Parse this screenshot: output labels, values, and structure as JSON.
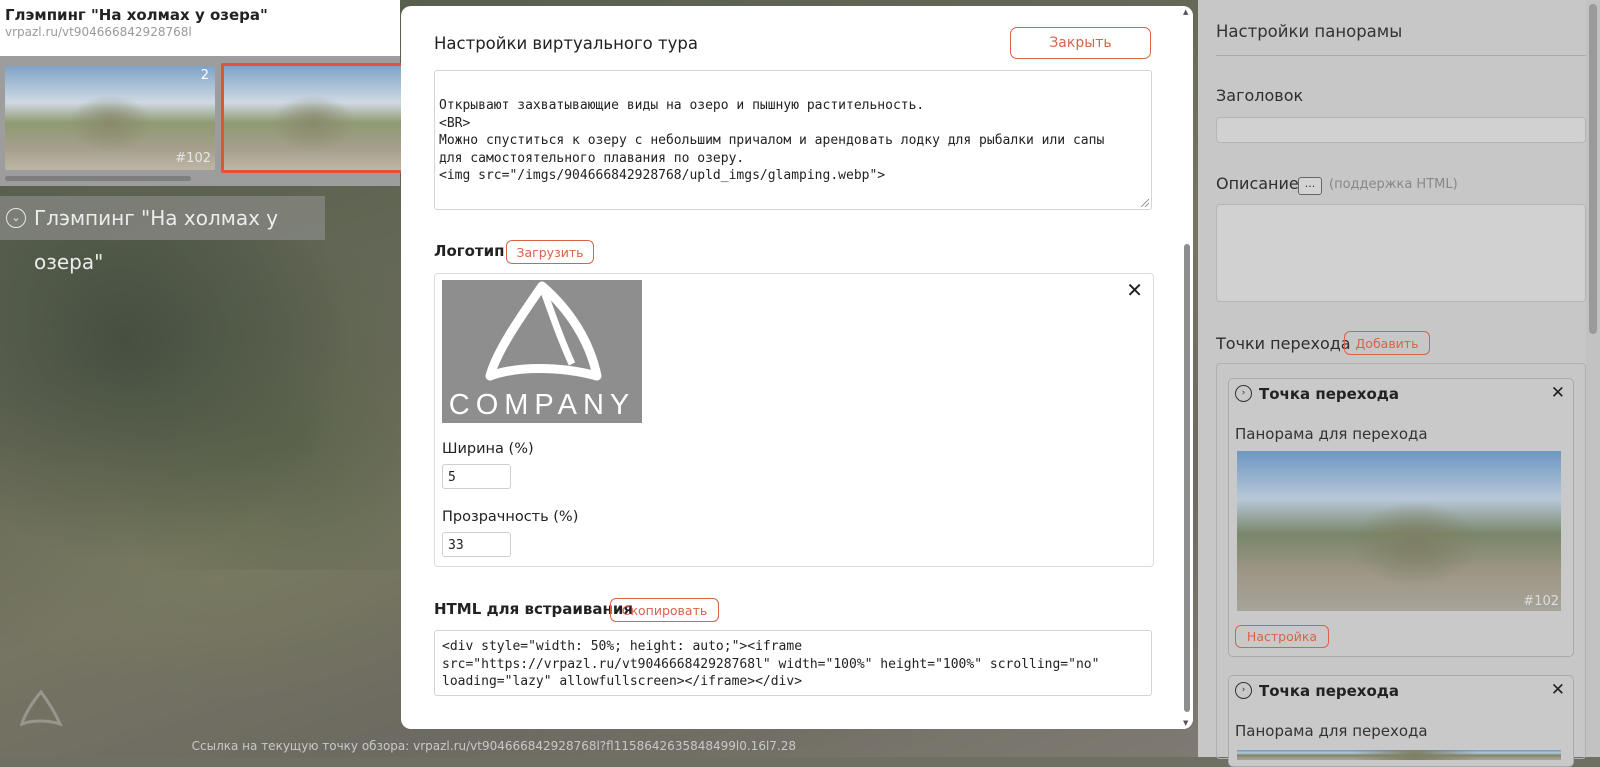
{
  "viewer": {
    "title": "Глэмпинг \"На холмах у озера\"",
    "url": "vrpazl.ru/vt904666842928768l",
    "thumbs": [
      {
        "count": "2",
        "number": "#102"
      },
      {
        "count": "",
        "number": ""
      }
    ],
    "scene_label": "Глэмпинг \"На холмах у озера\"",
    "status_link": "Ссылка на текущую точку обзора: vrpazl.ru/vt904666842928768l?fl1158642635848499l0.16l7.28"
  },
  "modal": {
    "title": "Настройки виртуального тура",
    "close_label": "Закрыть",
    "description_text": "Открывают захватывающие виды на озеро и пышную растительность.\n<BR>\nМожно спуститься к озеру с небольшим причалом и арендовать лодку для рыбалки или сапы\nдля самостоятельного плавания по озеру.\n<img src=\"/imgs/904666842928768/upld_imgs/glamping.webp\">",
    "logo": {
      "label": "Логотип",
      "upload_label": "Загрузить",
      "company_text": "COMPANY",
      "width_label": "Ширина (%)",
      "width_value": "5",
      "opacity_label": "Прозрачность (%)",
      "opacity_value": "33"
    },
    "embed": {
      "label": "HTML для встраивания",
      "copy_label": "Скопировать",
      "code": "<div style=\"width: 50%; height: auto;\"><iframe\nsrc=\"https://vrpazl.ru/vt904666842928768l\" width=\"100%\" height=\"100%\" scrolling=\"no\"\nloading=\"lazy\" allowfullscreen></iframe></div>"
    }
  },
  "right_panel": {
    "title": "Настройки панорамы",
    "heading_label": "Заголовок",
    "heading_value": "",
    "description_label": "Описание",
    "dots_label": "...",
    "description_hint": "(поддержка HTML)",
    "description_value": "",
    "transitions_label": "Точки перехода",
    "add_label": "Добавить",
    "cards": [
      {
        "title": "Точка перехода",
        "sub": "Панорама для перехода",
        "number": "#102",
        "settings_label": "Настройка"
      },
      {
        "title": "Точка перехода",
        "sub": "Панорама для перехода"
      }
    ]
  },
  "colors": {
    "accent": "#d9624a",
    "highlight": "#e2533a"
  }
}
